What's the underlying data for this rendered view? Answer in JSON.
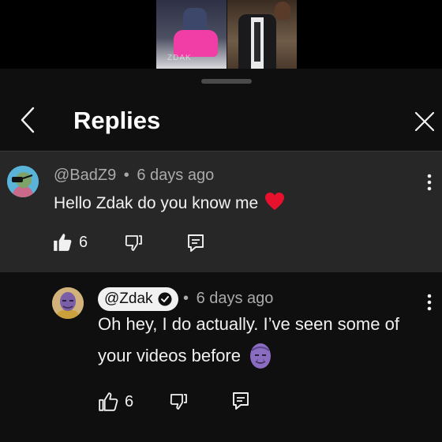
{
  "video": {
    "watermark": "ZDAK"
  },
  "header": {
    "title": "Replies"
  },
  "parent_comment": {
    "author": "@BadZ9",
    "time": "6 days ago",
    "text": "Hello Zdak do you know me",
    "emoji": "❤️",
    "like_count": "6"
  },
  "reply": {
    "author": "@Zdak",
    "time": "6 days ago",
    "text_line1": "Oh hey, I do actually. I’ve seen some of",
    "text_line2": "your videos before",
    "like_count": "6"
  },
  "separator": "•",
  "colors": {
    "background": "#0f0f0f",
    "highlight_row": "#272727",
    "secondary_text": "#aaaaaa",
    "heart": "#e8112d"
  }
}
